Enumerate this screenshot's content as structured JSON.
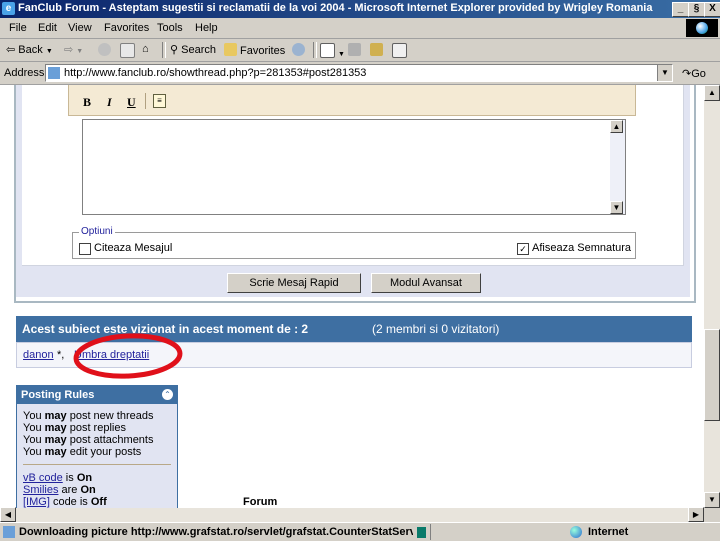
{
  "window": {
    "title": "FanClub Forum - Asteptam sugestii si reclamatii de la voi 2004 - Microsoft Internet Explorer provided by Wrigley Romania",
    "minimize": "_",
    "maximize": "§",
    "close": "X"
  },
  "menu": [
    "File",
    "Edit",
    "View",
    "Favorites",
    "Tools",
    "Help"
  ],
  "toolbar": {
    "back": "Back",
    "search": "Search",
    "favorites": "Favorites"
  },
  "address": {
    "label": "Address",
    "url": "http://www.fanclub.ro/showthread.php?p=281353#post281353",
    "go": "Go"
  },
  "editor": {
    "bold": "B",
    "italic": "I",
    "underline": "U"
  },
  "options": {
    "legend": "Optiuni",
    "quote_label": "Citeaza Mesajul",
    "quote_checked": false,
    "signature_label": "Afiseaza Semnatura",
    "signature_checked": true
  },
  "buttons": {
    "quick_reply": "Scrie Mesaj Rapid",
    "advanced": "Modul Avansat"
  },
  "viewers": {
    "header_bold": "Acest subiect este vizionat in acest moment de : 2",
    "header_detail": "(2 membri si 0 vizitatori)",
    "user1": "danon",
    "user1_suffix": "*,",
    "user2": "Umbra dreptatii"
  },
  "posting_rules": {
    "title": "Posting Rules",
    "lines": [
      {
        "pre": "You ",
        "bold": "may",
        "post": " post new threads"
      },
      {
        "pre": "You ",
        "bold": "may",
        "post": " post replies"
      },
      {
        "pre": "You ",
        "bold": "may",
        "post": " post attachments"
      },
      {
        "pre": "You ",
        "bold": "may",
        "post": " edit your posts"
      }
    ],
    "codes": [
      {
        "link": "vB code",
        "mid": " is ",
        "val": "On"
      },
      {
        "link": "Smilies",
        "mid": " are ",
        "val": "On"
      },
      {
        "link": "[IMG]",
        "mid": " code is ",
        "val": "Off"
      }
    ]
  },
  "forum_label": "Forum",
  "status": {
    "text": "Downloading picture http://www.grafstat.ro/servlet/grafstat.CounterStatServ",
    "zone": "Internet"
  },
  "colors": {
    "header_blue": "#3e6fa2",
    "panel_bg": "#e1e4f2",
    "annotation_red": "#e0101a"
  }
}
